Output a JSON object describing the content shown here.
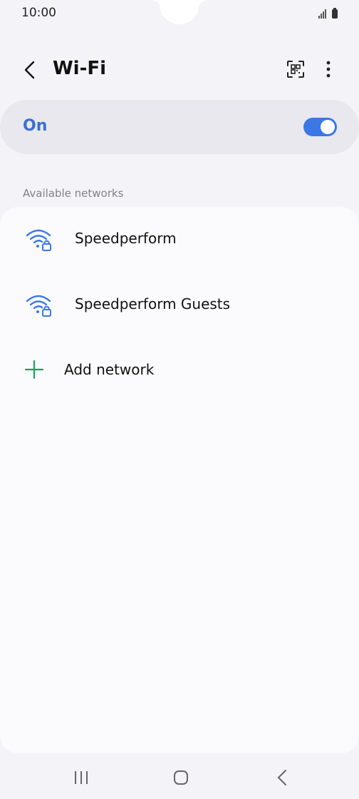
{
  "status_bar": {
    "time": "10:00"
  },
  "header": {
    "title": "Wi-Fi",
    "back_icon": "chevron-left-icon",
    "qr_icon": "qr-scan-icon",
    "more_icon": "more-vertical-icon"
  },
  "wifi_toggle": {
    "label": "On",
    "state": "on",
    "accent_color": "#3a78e6"
  },
  "available_networks": {
    "section_label": "Available networks",
    "items": [
      {
        "name": "Speedperform",
        "icon": "wifi-lock-icon",
        "secured": true
      },
      {
        "name": "Speedperform Guests",
        "icon": "wifi-lock-icon",
        "secured": true
      }
    ],
    "add_network": {
      "label": "Add network",
      "icon": "plus-icon",
      "icon_color": "#1aa260"
    }
  },
  "nav_bar": {
    "recents_icon": "recents-icon",
    "home_icon": "home-icon",
    "back_icon": "back-icon"
  }
}
